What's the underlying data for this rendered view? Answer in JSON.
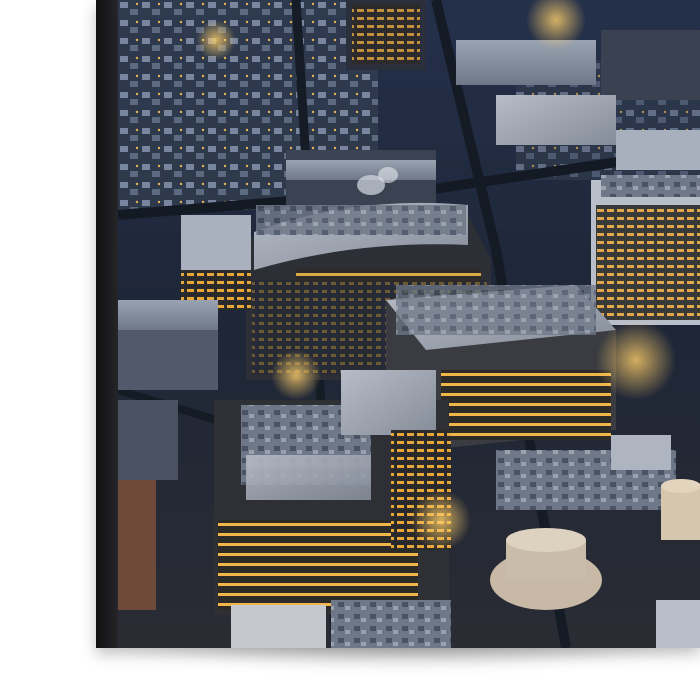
{
  "image": {
    "subject": "framed-canvas-print",
    "scene_icon": "city-aerial-night-photo-icon",
    "colors": {
      "page_background": "#ffffff",
      "canvas_edge": "#151518",
      "sky_dusk": "#2a3346",
      "rooftop_cool": "#8a94a6",
      "window_glow": "#f2b640",
      "street_shadow": "#1b2230"
    }
  }
}
